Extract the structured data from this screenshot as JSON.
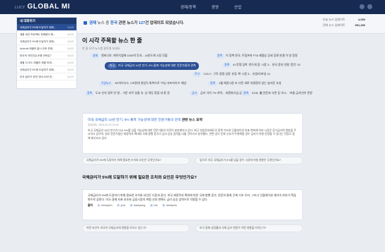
{
  "app": {
    "logo_sub": "LUCY",
    "logo_main": "GLOBAL MI"
  },
  "nav": {
    "items": [
      "경제/정책",
      "경영",
      "산업"
    ]
  },
  "infobar": {
    "prefix": "경제",
    "mid": " 뉴스 중 ",
    "country": "한국",
    "suffix": " 관련 뉴스가 ",
    "count": "127",
    "tail": "건 업데이트 되었습니다."
  },
  "stats": [
    {
      "label": "오늘 뉴스 업데이트",
      "value": "4,050"
    },
    {
      "label": "전체 뉴스 업데이트",
      "value": "981,280"
    }
  ],
  "sidebar": {
    "title": "내 대화하기",
    "items": [
      {
        "label": "국채금리가 5%에 도달하기 위해...",
        "time": "14:23"
      },
      {
        "label": "제품 비전 프로젝트 판매량이 예...",
        "time": "14:22"
      },
      {
        "label": "국채금리가 5%에 도달하기 위해...",
        "time": "14:22"
      },
      {
        "label": "Android 태블릿 출시 이후 판매...",
        "time": "14:22"
      },
      {
        "label": "한국의 국민연금 운용 전략은?",
        "time": "14:22"
      },
      {
        "label": "애플 이 모노 애플리 제품 미래...",
        "time": "14:22"
      },
      {
        "label": "국채금리가 5%에 도달하기 위해...",
        "time": "14:22"
      },
      {
        "label": "미국 달러가 완전 대비 20년 만...",
        "time": "14:22"
      }
    ]
  },
  "section": {
    "title": "이 시각 주목할 뉴스 한 줄",
    "subtitle": "한 줄 요약 뉴스를 클릭해 보세요."
  },
  "tags": [
    {
      "chip": "경제",
      "text": "엔비디아, 에이치엠에 1000억 투자... AI반도체 시장 진출"
    },
    {
      "chip": "정책",
      "text": "이 정책 한국, 트럼프와 FTA 재협상 공세 장관 판결 이 영 정정"
    },
    {
      "chip": "미국",
      "text": "미국 국채금리 10년 만기, 5% 돌파 가능성에 대한 전문가들의 관측"
    },
    {
      "chip": "정책",
      "text": "AI 전쟁 임박 '반도체 등' 시장 3... 한국 정부 연말 '혼란' 10"
    },
    {
      "chip": "주식",
      "text": "'LGU+', 구독 경쟁 성장 '유튜 책' 시장 3... 유원/모바일 10"
    },
    {
      "chip": "기업뉴스",
      "text": "SK하이닉스, 2조원대 영업익 회복으로 '어닝 서프라이즈' 예상"
    },
    {
      "chip": "정책",
      "text": "4월 채권시장 또 다른 새로 미결정이 었는 놀라운 사실"
    },
    {
      "chip": "정책",
      "text": "도교 신속 경로 만 명... 가운 카르 일을 추, 상 여당 정점 내 종 권"
    },
    {
      "chip": "금리",
      "text": "금리 가치 7% 하락... 외환위기급 급락"
    },
    {
      "chip": "정책",
      "text": "ECB, 美 연준과 다른 길 가나... '비둘 금리인하 전망'"
    }
  ],
  "summary": {
    "title_blue": "미국 국채금리 10년 만기, 5% 돌파 가능성에 대한 전문가들의 관측",
    "title_tail": " 관련 뉴스 요약",
    "date": "업데이트: 2024-04-23 15:46",
    "body": "미국 국채금리 10년 만기가 다시 5%를 넘을 가능성에 대한 전문가들의 의견이 분분해지고 있다. 최근 연방준비제도의 정책 기조와 인플레이션 지표 변화에 따라 시장은 장기금리의 향방을 주시하고 있으며, 일부 전문가들은 재정적자 확대와 국채 발행 증가가 금리 상승 압력을 더할 것이라고 분석했다. 반면 경기 둔화 신호가 뚜렷해질 경우 금리가 하향 안정될 수 있다는 전망도 함께 제기되고 있다."
  },
  "related": [
    "국채금리가 5%에 도달하기 위해 필요한 조치와 요인은 무엇인가요?",
    "앞으로 미국 국채금리가 5%를 넘을 경우 시장에 미칠 영향은 무엇인가요?"
  ],
  "question": {
    "title": "국채금리가 5%에 도달하기 위해 필요한 조치와 요인은 무엇인가요?"
  },
  "answer": {
    "body": "국채금리가 5%에 도달하기 위해 필요한 조치와 요인은 다음과 같다. 미국 재정적자 확대에 따른 국채 발행 증가, 연준의 통화 긴축 기조 유지, 그리고 인플레이션 재가속 여부가 핵심 변수로 꼽힌다. 미국 경제 지표 호조와 금융시장의 위험 선호 변화도 금리 상승 압력으로 작용할 수 있다.",
    "sources_label": "출처",
    "sources": [
      {
        "n": "1",
        "name": "newsprm"
      },
      {
        "n": "2",
        "name": "yna"
      },
      {
        "n": "3",
        "name": "hankyung"
      },
      {
        "n": "4",
        "name": "mk"
      },
      {
        "n": "5",
        "name": "newsprm"
      }
    ]
  },
  "followups": [
    "어떤 요인이 미국의 국채금리에 영향을 미치고 있는가?",
    "미국 경제 성장률과 국채 금리 변동이 어떤 영향을 미치는가?"
  ]
}
